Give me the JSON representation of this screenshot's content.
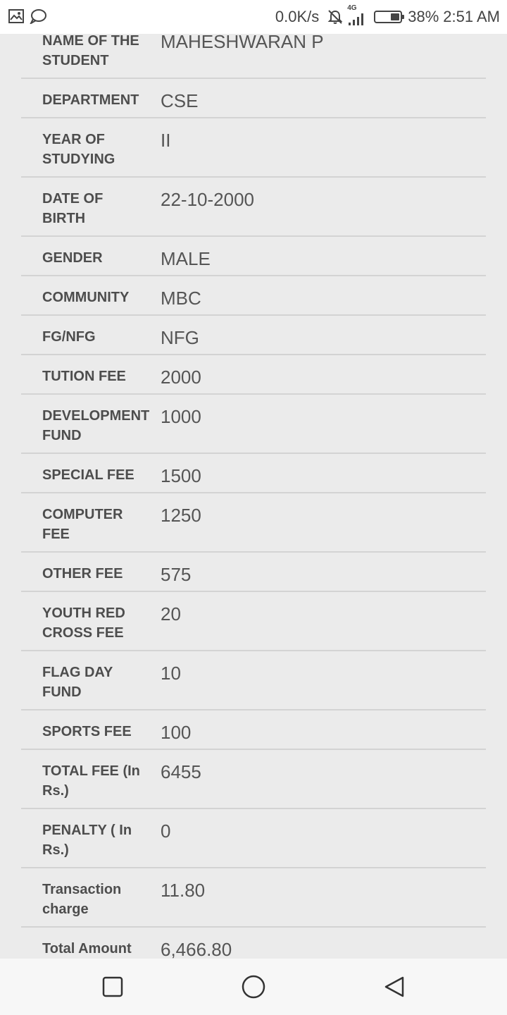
{
  "status_bar": {
    "network_speed": "0.0K/s",
    "network_type": "4G",
    "battery_percent": "38%",
    "battery_level": 0.38,
    "time": "2:51 AM",
    "icons": [
      "gallery-icon",
      "chat-bubble-icon",
      "muted-bell-icon",
      "signal-icon",
      "battery-icon"
    ]
  },
  "student_details": {
    "rows": [
      {
        "label": "NAME OF THE STUDENT",
        "value": "MAHESHWARAN P"
      },
      {
        "label": "DEPARTMENT",
        "value": "CSE"
      },
      {
        "label": "YEAR OF STUDYING",
        "value": "II"
      },
      {
        "label": "DATE OF BIRTH",
        "value": "22-10-2000"
      },
      {
        "label": "GENDER",
        "value": "MALE"
      },
      {
        "label": "COMMUNITY",
        "value": "MBC"
      },
      {
        "label": "FG/NFG",
        "value": "NFG"
      },
      {
        "label": "TUTION FEE",
        "value": "2000"
      },
      {
        "label": "DEVELOPMENT FUND",
        "value": "1000"
      },
      {
        "label": "SPECIAL FEE",
        "value": "1500"
      },
      {
        "label": "COMPUTER FEE",
        "value": "1250"
      },
      {
        "label": "OTHER FEE",
        "value": "575"
      },
      {
        "label": "YOUTH RED CROSS FEE",
        "value": "20"
      },
      {
        "label": "FLAG DAY FUND",
        "value": "10"
      },
      {
        "label": "SPORTS FEE",
        "value": "100"
      },
      {
        "label": "TOTAL FEE (In Rs.)",
        "value": "6455"
      },
      {
        "label": "PENALTY ( In Rs.)",
        "value": "0"
      },
      {
        "label": "Transaction charge",
        "value": "11.80"
      },
      {
        "label": "Total Amount",
        "value": "6,466.80"
      }
    ]
  },
  "nav_bar": {
    "buttons": [
      "recents-square-icon",
      "home-circle-icon",
      "back-triangle-icon"
    ]
  }
}
